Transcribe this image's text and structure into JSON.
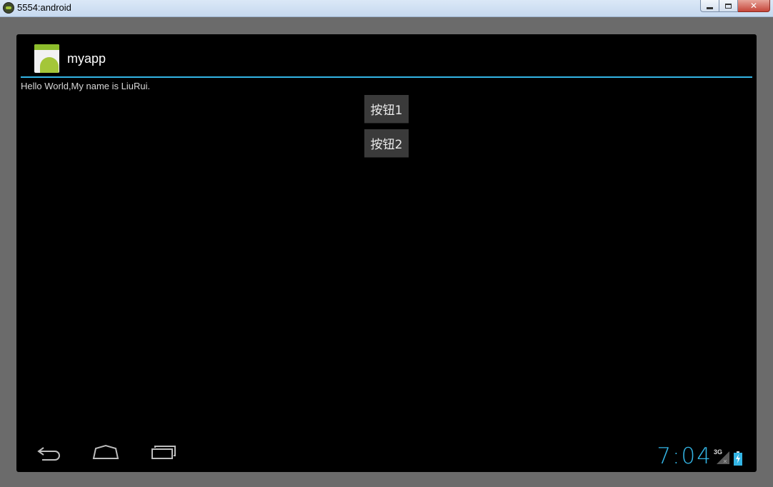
{
  "window": {
    "title": "5554:android",
    "close_glyph": "✕"
  },
  "app": {
    "title": "myapp",
    "icon": "android-app-icon",
    "accent_color": "#33b5e5"
  },
  "content": {
    "hello_text": "Hello World,My name is LiuRui.",
    "button1_label": "按钮1",
    "button2_label": "按钮2"
  },
  "nav_bar": {
    "back_icon": "back-icon",
    "home_icon": "home-icon",
    "recent_apps_icon": "recent-apps-icon"
  },
  "status_bar": {
    "time": "7:04",
    "network_type": "3G",
    "signal_icon": "signal-icon",
    "battery_icon": "battery-charging-icon"
  }
}
